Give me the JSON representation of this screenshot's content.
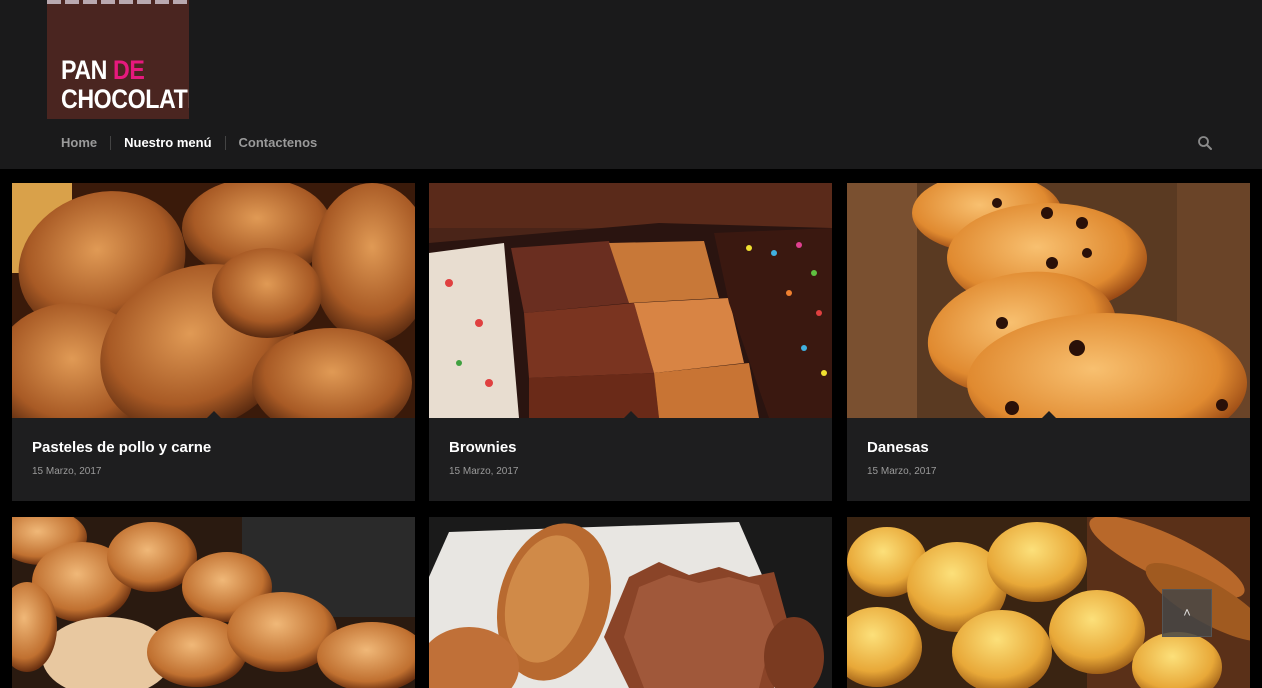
{
  "brand": {
    "logo_line1": "PAN",
    "logo_accent": "DE",
    "logo_line2": "CHOCOLATE",
    "accent_color": "#e6197d"
  },
  "nav": {
    "items": [
      {
        "label": "Home",
        "active": false
      },
      {
        "label": "Nuestro menú",
        "active": true
      },
      {
        "label": "Contactenos",
        "active": false
      }
    ],
    "search_icon": "search-icon"
  },
  "posts": [
    {
      "title": "Pasteles de pollo y carne",
      "date": "15 Marzo, 2017",
      "image": "chicken-meat-pastries"
    },
    {
      "title": "Brownies",
      "date": "15 Marzo, 2017",
      "image": "brownies-tray"
    },
    {
      "title": "Danesas",
      "date": "15 Marzo, 2017",
      "image": "danish-pastries-basket"
    },
    {
      "title": "",
      "date": "",
      "image": "croissants-basket"
    },
    {
      "title": "",
      "date": "",
      "image": "palmeras-chocolate"
    },
    {
      "title": "",
      "date": "",
      "image": "cheese-bread-rolls"
    }
  ],
  "scroll_top": {
    "label": "˄",
    "icon": "chevron-up-icon"
  },
  "colors": {
    "header_bg": "#1a1a1b",
    "card_bg": "#1e1e1f",
    "page_bg": "#000000"
  }
}
